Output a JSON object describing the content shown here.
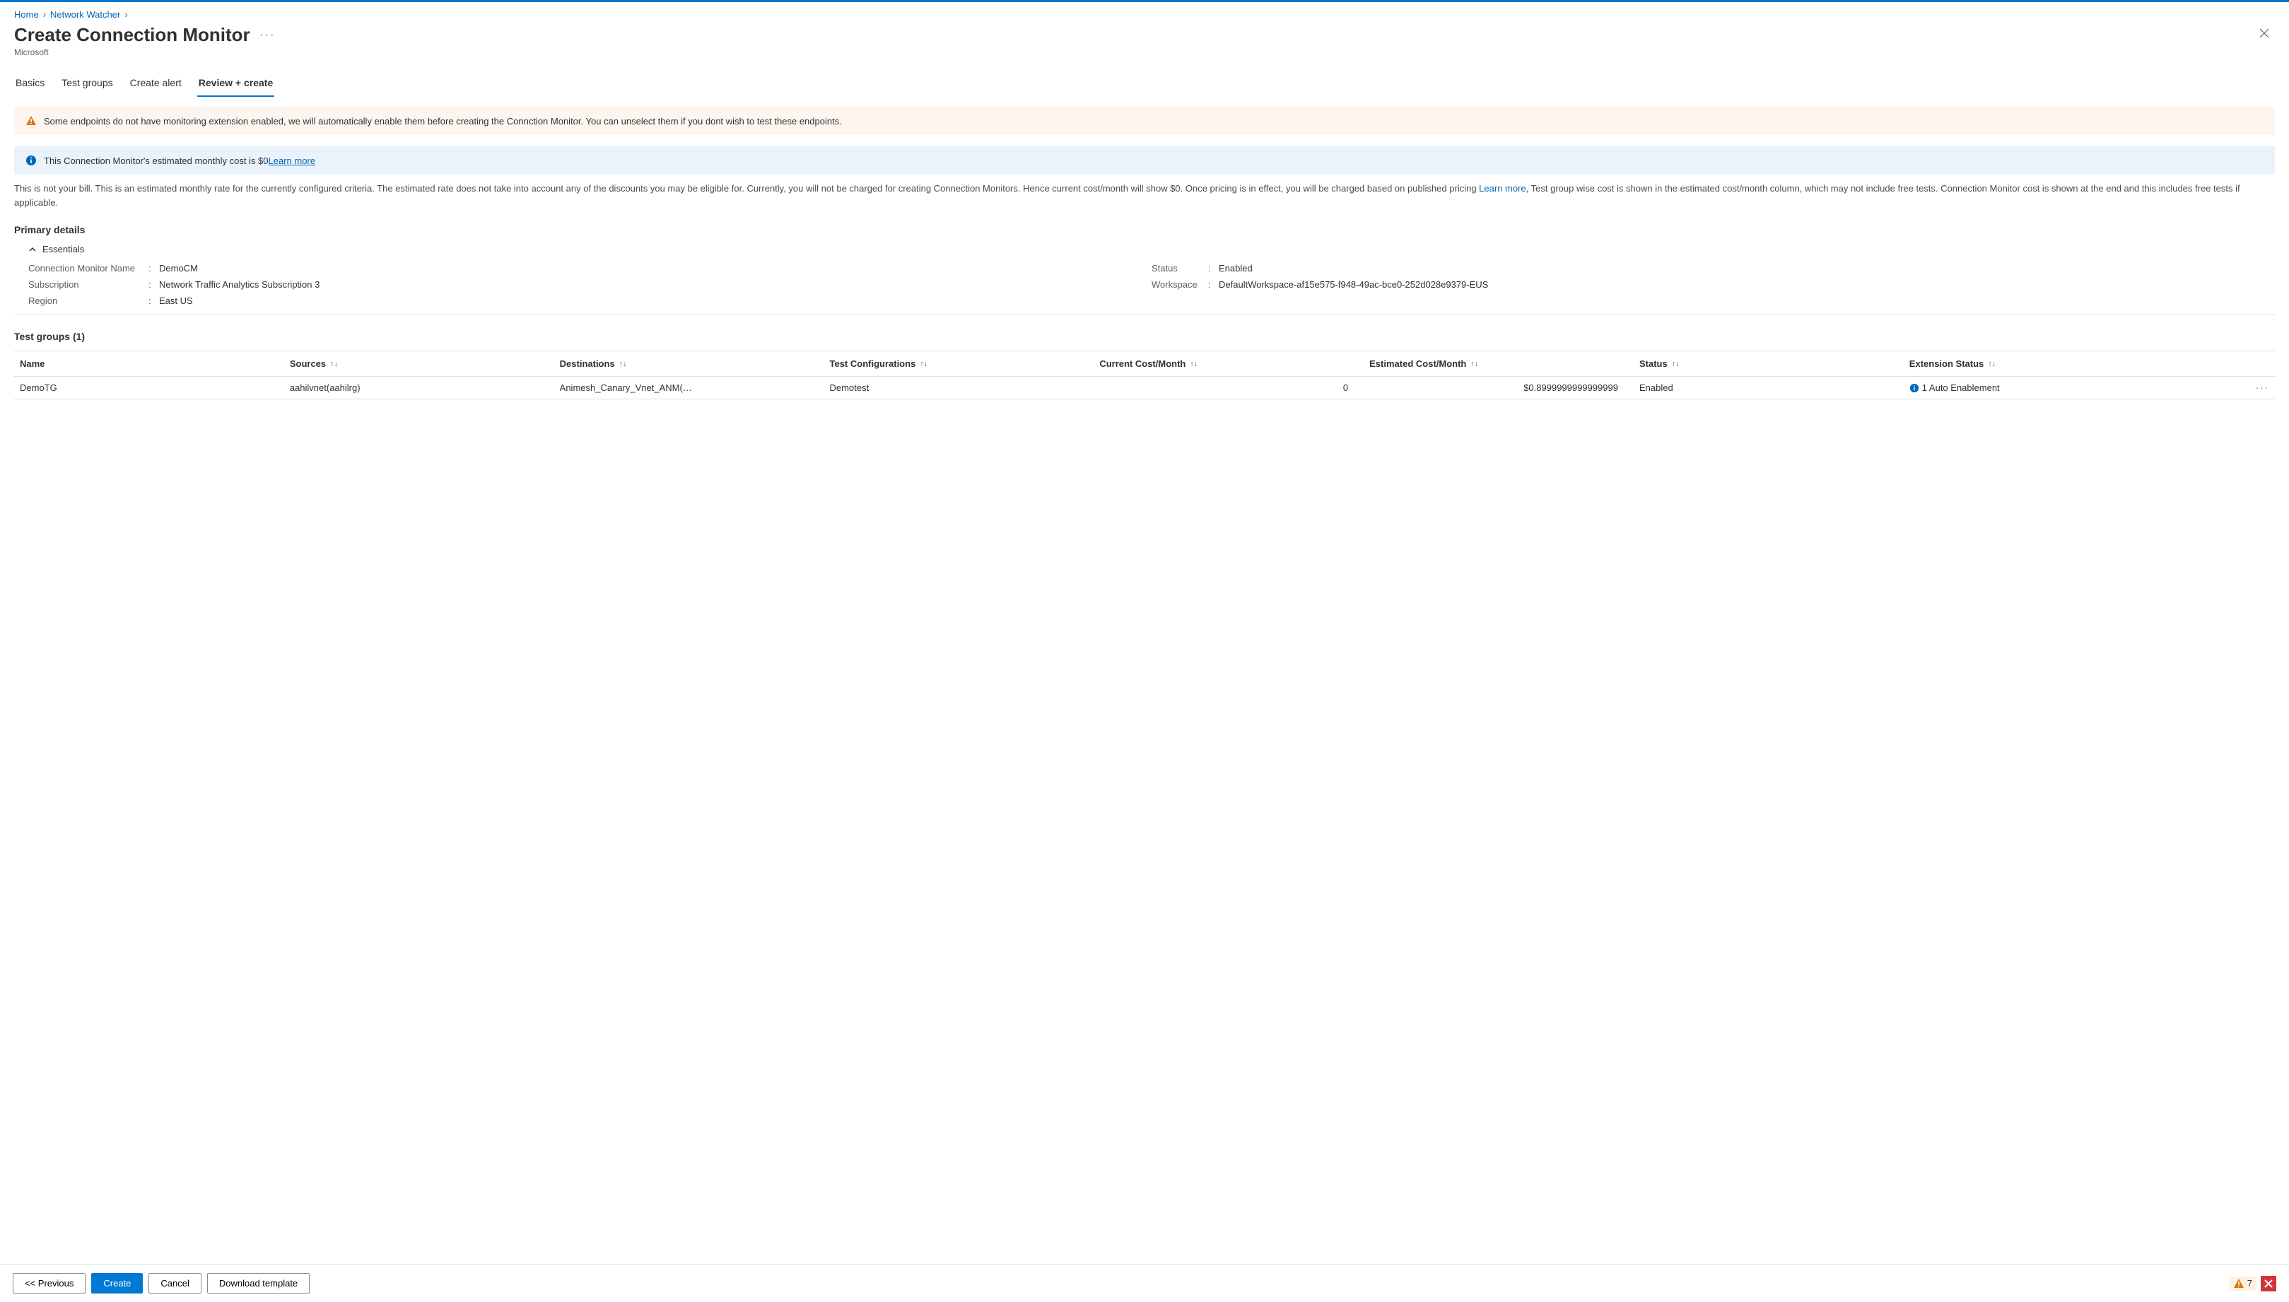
{
  "breadcrumb": {
    "home": "Home",
    "nw": "Network Watcher"
  },
  "header": {
    "title": "Create Connection Monitor",
    "subtitle": "Microsoft"
  },
  "tabs": {
    "basics": "Basics",
    "testgroups": "Test groups",
    "createalert": "Create alert",
    "review": "Review + create"
  },
  "banner_warning": "Some endpoints do not have monitoring extension enabled, we will automatically enable them before creating the Connction Monitor. You can unselect them if you dont wish to test these endpoints.",
  "banner_info_text": "This Connection Monitor's estimated monthly cost is $0",
  "banner_info_link": "Learn more",
  "body_text_1": "This is not your bill. This is an estimated monthly rate for the currently configured criteria. The estimated rate does not take into account any of the discounts you may be eligible for. Currently, you will not be charged for creating Connection Monitors. Hence current cost/month will show $0. Once pricing is in effect, you will be charged based on published pricing ",
  "body_link": "Learn more",
  "body_text_2": ", Test group wise cost is shown in the estimated cost/month column, which may not include free tests. Connection Monitor cost is shown at the end and this includes free tests if applicable.",
  "primary_details_title": "Primary details",
  "essentials_label": "Essentials",
  "essentials": {
    "cm_name_label": "Connection Monitor Name",
    "cm_name_value": "DemoCM",
    "sub_label": "Subscription",
    "sub_value": "Network Traffic Analytics Subscription 3",
    "region_label": "Region",
    "region_value": "East US",
    "status_label": "Status",
    "status_value": "Enabled",
    "workspace_label": "Workspace",
    "workspace_value": "DefaultWorkspace-af15e575-f948-49ac-bce0-252d028e9379-EUS"
  },
  "tg_title": "Test groups (1)",
  "columns": {
    "name": "Name",
    "sources": "Sources",
    "destinations": "Destinations",
    "tc": "Test Configurations",
    "cc": "Current Cost/Month",
    "ec": "Estimated Cost/Month",
    "status": "Status",
    "ext": "Extension Status"
  },
  "row": {
    "name": "DemoTG",
    "sources": "aahilvnet(aahilrg)",
    "destinations": "Animesh_Canary_Vnet_ANM(…",
    "tc": "Demotest",
    "cc": "0",
    "ec": "$0.8999999999999999",
    "status": "Enabled",
    "ext": "1 Auto Enablement"
  },
  "footer": {
    "previous": "<< Previous",
    "create": "Create",
    "cancel": "Cancel",
    "download": "Download template",
    "notif_count": "7"
  }
}
